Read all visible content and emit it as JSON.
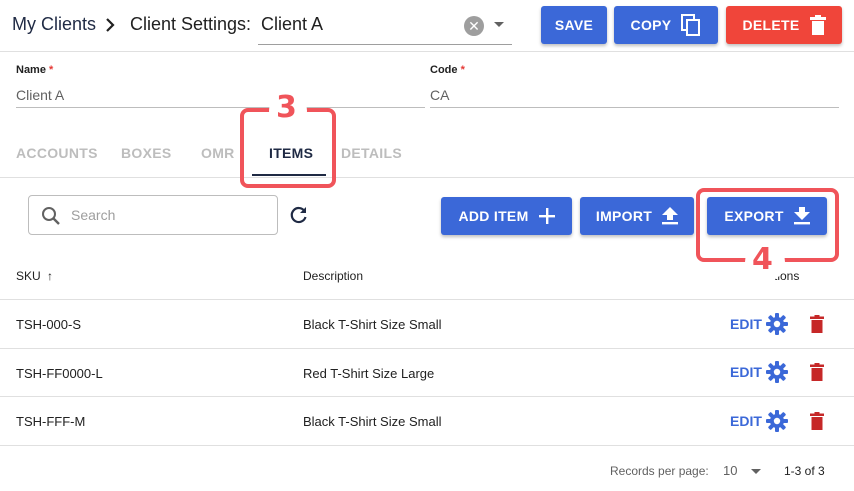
{
  "header": {
    "breadcrumb_root": "My Clients",
    "breadcrumb_sep": ">",
    "breadcrumb_current": "Client Settings:",
    "client_value": "Client A",
    "clear_symbol": "✕",
    "save_label": "SAVE",
    "copy_label": "COPY",
    "delete_label": "DELETE"
  },
  "fields": {
    "name_label": "Name",
    "name_value": "Client A",
    "code_label": "Code",
    "code_value": "CA",
    "required_mark": "*"
  },
  "tabs": [
    {
      "label": "ACCOUNTS"
    },
    {
      "label": "BOXES"
    },
    {
      "label": "OMR"
    },
    {
      "label": "ITEMS",
      "active": true
    },
    {
      "label": "DETAILS"
    }
  ],
  "toolbar": {
    "search_placeholder": "Search",
    "add_item_label": "ADD ITEM",
    "import_label": "IMPORT",
    "export_label": "EXPORT"
  },
  "table": {
    "columns": {
      "sku": "SKU",
      "sort_arrow": "↑",
      "description": "Description",
      "actions": "Actions"
    },
    "rows": [
      {
        "sku": "TSH-000-S",
        "description": "Black T-Shirt Size Small",
        "edit": "EDIT"
      },
      {
        "sku": "TSH-FF0000-L",
        "description": "Red T-Shirt Size Large",
        "edit": "EDIT"
      },
      {
        "sku": "TSH-FFF-M",
        "description": "Black T-Shirt Size Small",
        "edit": "EDIT"
      }
    ]
  },
  "pagination": {
    "records_label": "Records per page:",
    "per_page": "10",
    "range": "1-3 of 3"
  },
  "annotations": {
    "step_items": "3",
    "step_export": "4"
  },
  "colors": {
    "primary": "#3b68d8",
    "danger": "#f0453a",
    "annotation": "#f0545a",
    "active_tab": "#1f2a44"
  },
  "icons": [
    "chevron-right-icon",
    "clear-icon",
    "dropdown-caret-icon",
    "copy-icon",
    "trash-icon",
    "search-icon",
    "refresh-icon",
    "plus-icon",
    "upload-icon",
    "download-icon",
    "arrow-up-icon",
    "gear-icon"
  ]
}
